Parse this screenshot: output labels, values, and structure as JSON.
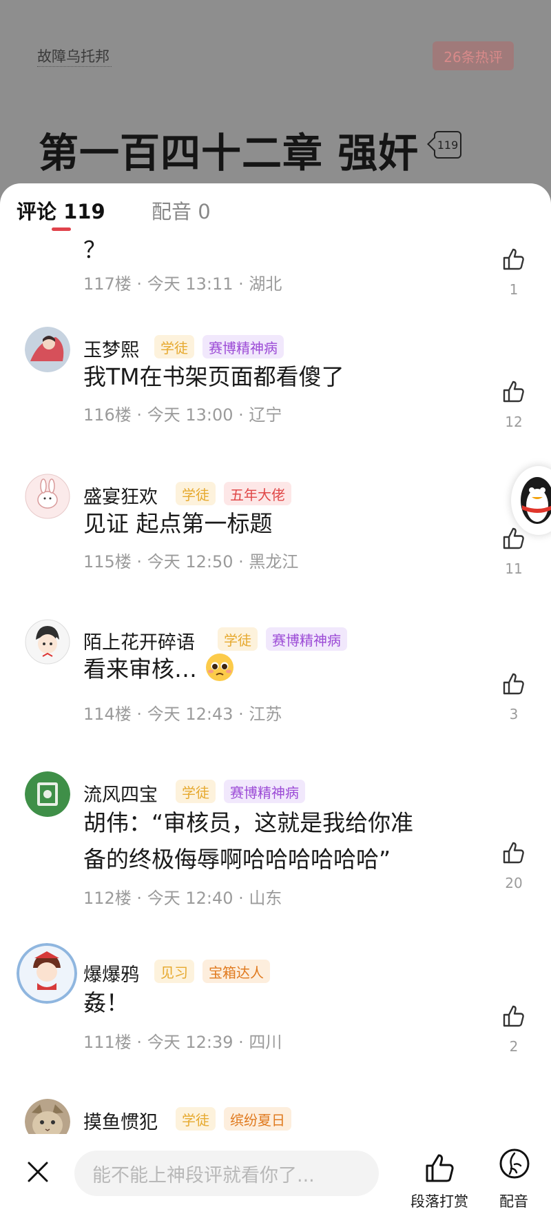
{
  "header": {
    "author": "故障乌托邦",
    "hot_badge": "26条热评",
    "chapter_title": "第一百四十二章 强奸",
    "title_count": "119"
  },
  "tabs": {
    "comments_label": "评论 119",
    "dub_label": "配音 0"
  },
  "comments": [
    {
      "text": "？",
      "meta": "117楼 · 今天 13:11 · 湖北",
      "likes": "1"
    },
    {
      "user": "玉梦熙",
      "badges": [
        "学徒",
        "赛博精神病"
      ],
      "text": "我TM在书架页面都看傻了",
      "meta": "116楼 · 今天 13:00 · 辽宁",
      "likes": "12"
    },
    {
      "user": "盛宴狂欢",
      "badges": [
        "学徒",
        "五年大佬"
      ],
      "text": "见证 起点第一标题",
      "meta": "115楼 · 今天 12:50 · 黑龙江",
      "likes": "11"
    },
    {
      "user": "陌上花开碎语",
      "badges": [
        "学徒",
        "赛博精神病"
      ],
      "text": "看来审核…",
      "emoji": "pleading-face-emoji",
      "meta": "114楼 · 今天 12:43 · 江苏",
      "likes": "3"
    },
    {
      "user": "流风四宝",
      "badges": [
        "学徒",
        "赛博精神病"
      ],
      "text_line1": "胡伟：“审核员，这就是我给你准",
      "text_line2": "备的终极侮辱啊哈哈哈哈哈哈”",
      "meta": "112楼 · 今天 12:40 · 山东",
      "likes": "20"
    },
    {
      "user": "爆爆鸦",
      "badges": [
        "见习",
        "宝箱达人"
      ],
      "text": "姦！",
      "meta": "111楼 · 今天 12:39 · 四川",
      "likes": "2"
    },
    {
      "user": "摸鱼惯犯",
      "badges": [
        "学徒",
        "缤纷夏日"
      ]
    }
  ],
  "bottom_bar": {
    "input_placeholder": "能不能上神段评就看你了...",
    "tip_label": "段落打赏",
    "dub_label": "配音"
  },
  "colors": {
    "accent": "#e0424b",
    "overlay": "#8e8e8e",
    "muted_text": "#9b9b9b"
  }
}
